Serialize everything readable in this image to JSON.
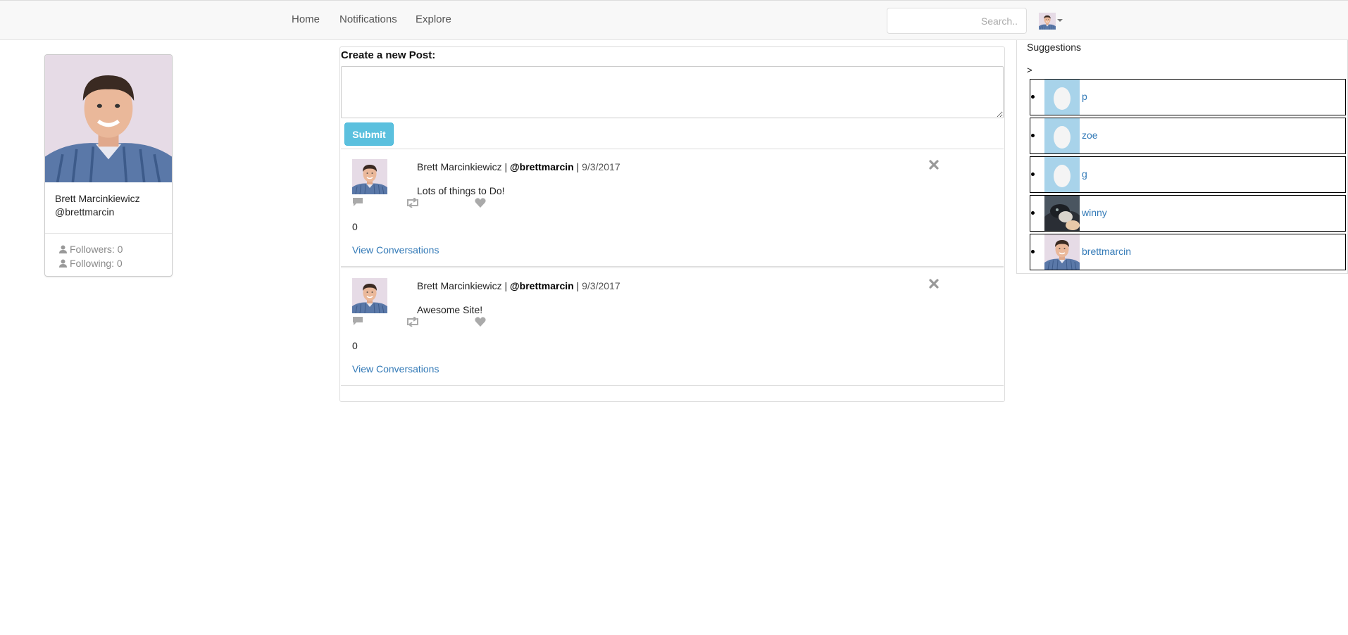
{
  "nav": {
    "links": [
      "Home",
      "Notifications",
      "Explore"
    ],
    "search_placeholder": "Search.."
  },
  "profile": {
    "name": "Brett Marcinkiewicz",
    "handle": "@brettmarcin",
    "followers": "Followers: 0",
    "following": "Following: 0"
  },
  "composer": {
    "label": "Create a new Post:",
    "submit": "Submit"
  },
  "posts": [
    {
      "author": "Brett Marcinkiewicz",
      "sep1": " | ",
      "handle": "@brettmarcin",
      "sep2": " | ",
      "date": "9/3/2017",
      "text": "Lots of things to Do!",
      "count": "0",
      "link": "View Conversations"
    },
    {
      "author": "Brett Marcinkiewicz",
      "sep1": " | ",
      "handle": "@brettmarcin",
      "sep2": " | ",
      "date": "9/3/2017",
      "text": "Awesome Site!",
      "count": "0",
      "link": "View Conversations"
    }
  ],
  "suggestions": {
    "title": "Suggestions",
    "marker": ">",
    "items": [
      {
        "name": "p",
        "avatar": "egg-avatar"
      },
      {
        "name": "zoe",
        "avatar": "egg-avatar"
      },
      {
        "name": "g",
        "avatar": "egg-avatar"
      },
      {
        "name": "winny",
        "avatar": "pet-photo"
      },
      {
        "name": "brettmarcin",
        "avatar": "user-photo"
      }
    ]
  },
  "colors": {
    "link": "#337ab7",
    "submit": "#5bc0de",
    "egg_bg": "#a8d3ea",
    "icon_gray": "#aaaaaa"
  }
}
